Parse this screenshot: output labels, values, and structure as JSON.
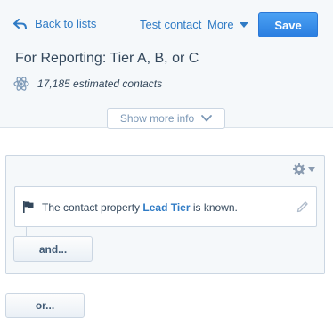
{
  "header": {
    "back_label": "Back to lists",
    "test_contact_label": "Test contact",
    "more_label": "More",
    "save_label": "Save",
    "list_title": "For Reporting: Tier A, B, or C",
    "estimate_text": "17,185 estimated contacts",
    "show_more_label": "Show more info"
  },
  "filters": {
    "group": {
      "condition": {
        "prefix": "The contact property ",
        "property": "Lead Tier",
        "suffix": " is known."
      },
      "and_label": "and..."
    },
    "or_label": "or..."
  },
  "colors": {
    "accent": "#2f7bc5",
    "save_button": "#3c8fe8",
    "panel_bg": "#f5f8fa",
    "border": "#cbd6e2"
  },
  "icons": {
    "back": "back-arrow-icon",
    "more": "caret-down-icon",
    "estimate": "atom-icon",
    "show_more": "chevron-down-icon",
    "settings": "gear-icon",
    "condition": "flag-icon",
    "edit": "pencil-icon"
  }
}
